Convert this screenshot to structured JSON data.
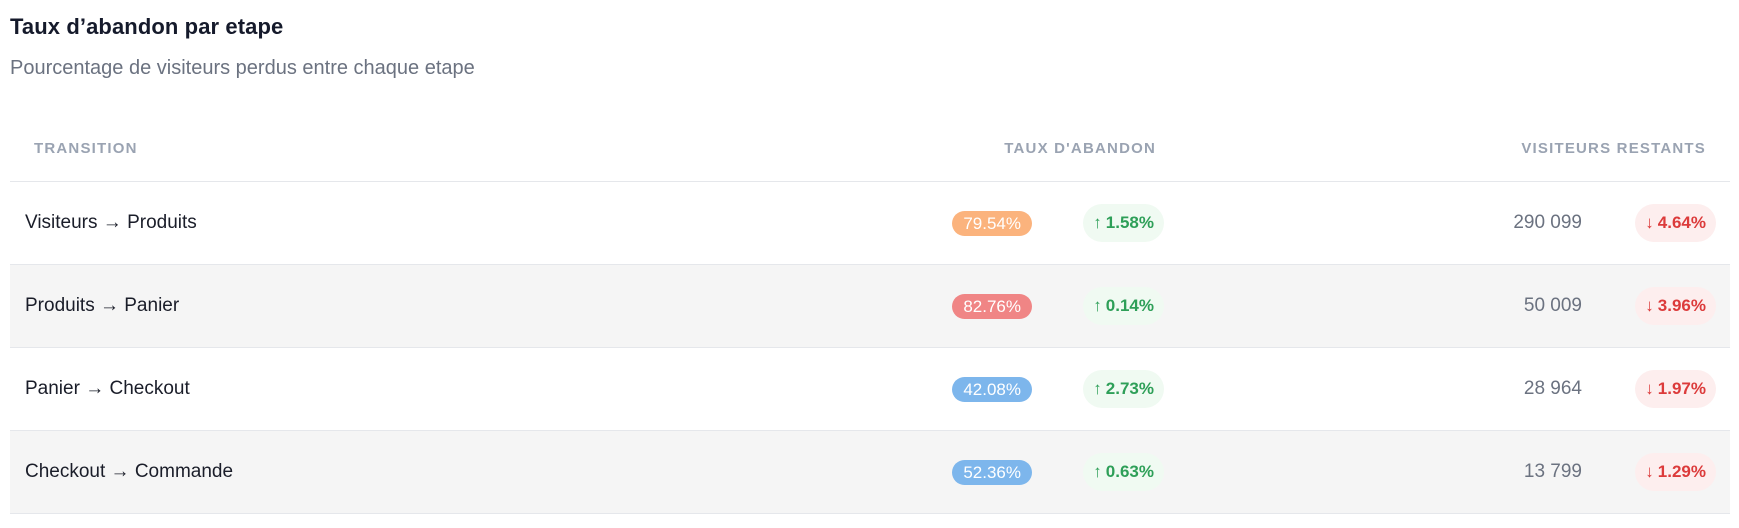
{
  "header": {
    "title": "Taux d’abandon par etape",
    "subtitle": "Pourcentage de visiteurs perdus entre chaque etape"
  },
  "table": {
    "columns": [
      "TRANSITION",
      "TAUX D'ABANDON",
      "VISITEURS RESTANTS"
    ],
    "rows": [
      {
        "transition": "Visiteurs → Produits",
        "rate": "79.54%",
        "rate_color": "#fbb37d",
        "rate_change": "1.58%",
        "visitors": "290 099",
        "visitors_change": "4.64%"
      },
      {
        "transition": "Produits → Panier",
        "rate": "82.76%",
        "rate_color": "#f08585",
        "rate_change": "0.14%",
        "visitors": "50 009",
        "visitors_change": "3.96%"
      },
      {
        "transition": "Panier → Checkout",
        "rate": "42.08%",
        "rate_color": "#7db6ec",
        "rate_change": "2.73%",
        "visitors": "28 964",
        "visitors_change": "1.97%"
      },
      {
        "transition": "Checkout → Commande",
        "rate": "52.36%",
        "rate_color": "#7db6ec",
        "rate_change": "0.63%",
        "visitors": "13 799",
        "visitors_change": "1.29%"
      }
    ]
  },
  "icons": {
    "up": "arrow-up-icon",
    "down": "arrow-down-icon"
  },
  "colors": {
    "up_text": "#2e9f58",
    "up_bg": "#f0faf2",
    "down_text": "#dc3b3b",
    "down_bg": "#fdeeee"
  }
}
